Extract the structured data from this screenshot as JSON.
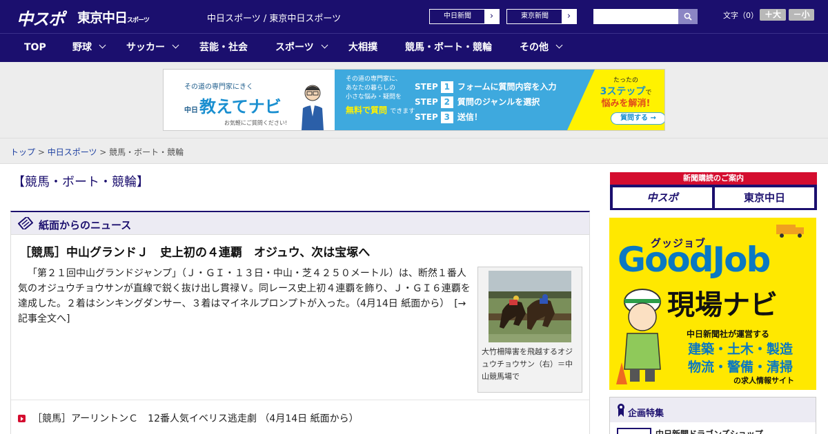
{
  "header": {
    "logo_chuspo": "中スポ",
    "logo_tokyo": "東京中日",
    "logo_tokyo_suffix": "スポーツ",
    "site_links": "中日スポーツ / 東京中日スポーツ",
    "chunichi_btn": "中日新聞",
    "tokyo_btn": "東京新聞",
    "search_placeholder": "",
    "font_label": "文字（0）",
    "font_up": "＋大",
    "font_down": "－小"
  },
  "nav": {
    "items": [
      {
        "label": "TOP"
      },
      {
        "label": "野球"
      },
      {
        "label": "サッカー"
      },
      {
        "label": "芸能・社会"
      },
      {
        "label": "スポーツ"
      },
      {
        "label": "大相撲"
      },
      {
        "label": "競馬・ボート・競輪"
      },
      {
        "label": "その他"
      }
    ]
  },
  "banner": {
    "tagline": "その道の専門家にきく",
    "name_prefix": "中日",
    "name": "教えてナビ",
    "note": "お気軽にご質問ください!",
    "mid_text_1": "その道の専門家に、",
    "mid_text_2": "あなたの暮らしの",
    "mid_text_3": "小さな悩み・疑問を",
    "free": "無料で質問",
    "free_suffix": "できます",
    "step1": "フォームに質問内容を入力",
    "step2": "質問のジャンルを選択",
    "step3": "送信！",
    "step_word": "STEP",
    "right_1": "たったの",
    "right_2": "3ステップ",
    "right_3": "で",
    "right_4": "悩みを解消!",
    "cta": "質問する →"
  },
  "breadcrumb": {
    "home": "トップ",
    "section": "中日スポーツ",
    "current": "競馬・ボート・競輪",
    "sep": " > "
  },
  "main": {
    "page_title": "【競馬・ボート・競輪】",
    "box_title": "紙面からのニュース",
    "lead_title": "［競馬］中山グランドＪ　史上初の４連覇　オジュウ、次は宝塚へ",
    "lead_body": "「第２１回中山グランドジャンプ」（Ｊ・ＧＩ・１３日・中山・芝４２５０メートル）は、断然１番人気のオジュウチョウサンが直線で鋭く抜け出し貫禄Ｖ。同レース史上初４連覇を飾り、Ｊ・ＧＩ６連覇を達成した。２着はシンキングダンサー、３着はマイネルプロンプトが入った。（4月14日 紙面から）　[→記事全文へ]",
    "caption": "大竹柵障害を飛越するオジュウチョウサン（右）＝中山競馬場で",
    "sub_item": "［競馬］アーリントンＣ　12番人気イベリス逃走劇 （4月14日 紙面から）"
  },
  "sidebar": {
    "promo_top": "新聞購読のご案内",
    "promo_logo1": "中スポ",
    "promo_logo2": "東京中日",
    "ad_ruby": "グッジョブ",
    "ad_title": "GoodJob",
    "ad_sub": "現場ナビ",
    "ad_operator": "中日新聞社が運営する",
    "ad_cat1": "建築・土木・製造",
    "ad_cat2": "物流・警備・清掃",
    "ad_site": "の求人情報サイト",
    "feature_title": "企画特集",
    "feature_item": "中日新聞ドラゴンズショップ"
  },
  "colors": {
    "brand_navy": "#1b0f6e",
    "accent_red": "#d40d2f",
    "link_blue": "#1b3ea0",
    "ad_yellow": "#ffe800"
  }
}
